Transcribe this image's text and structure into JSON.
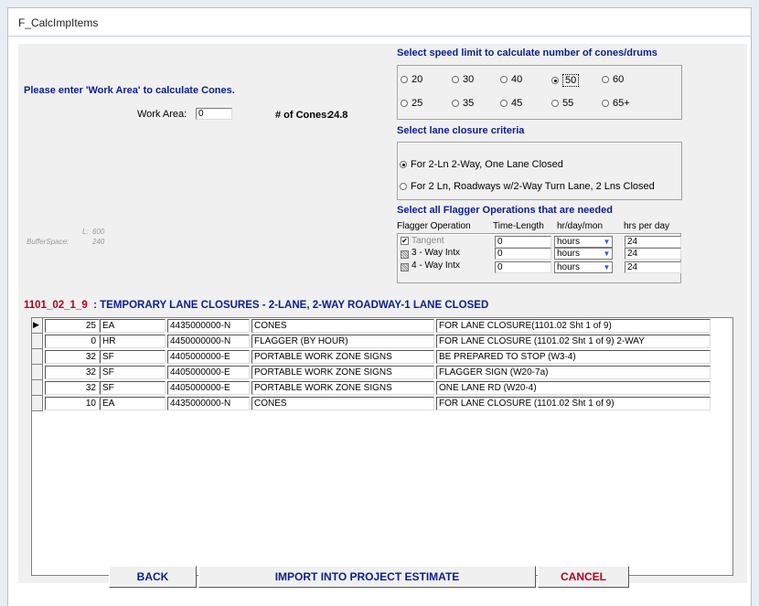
{
  "window": {
    "title": "F_CalcImpItems"
  },
  "left": {
    "prompt": "Please enter 'Work Area' to calculate Cones.",
    "work_area_label": "Work Area:",
    "work_area_value": "0",
    "cones_label": "# of Cones:",
    "cones_value": "24.8",
    "l_label": "L:",
    "l_value": "600",
    "buffer_label": "BufferSpace:",
    "buffer_value": "240"
  },
  "speed": {
    "heading": "Select speed limit to calculate number of cones/drums",
    "row1": [
      "20",
      "30",
      "40",
      "50",
      "60"
    ],
    "row2": [
      "25",
      "35",
      "45",
      "55",
      "65+"
    ],
    "selected": "50"
  },
  "lane": {
    "heading": "Select lane closure criteria",
    "options": [
      "For 2-Ln 2-Way, One Lane Closed",
      "For 2 Ln, Roadways w/2-Way Turn Lane, 2 Lns Closed"
    ],
    "selected_index": 0
  },
  "flagger": {
    "heading": "Select all Flagger Operations that are needed",
    "headers": [
      "Flagger Operation",
      "Time-Length",
      "hr/day/mon",
      "hrs per day"
    ],
    "rows": [
      {
        "name": "Tangent",
        "time": "0",
        "unit": "hours",
        "hrs": "24",
        "state": "checked"
      },
      {
        "name": "3 - Way Intx",
        "time": "0",
        "unit": "hours",
        "hrs": "24",
        "state": "indeterminate"
      },
      {
        "name": "4 - Way Intx",
        "time": "0",
        "unit": "hours",
        "hrs": "24",
        "state": "indeterminate"
      }
    ]
  },
  "section": {
    "code": "1101_02_1_9",
    "title": "  : TEMPORARY LANE CLOSURES - 2-LANE, 2-WAY ROADWAY-1 LANE CLOSED"
  },
  "table": {
    "rows": [
      [
        "25",
        "EA",
        "4435000000-N",
        "CONES",
        "FOR LANE CLOSURE(1101.02 Sht 1 of 9)"
      ],
      [
        "0",
        "HR",
        "4450000000-N",
        "FLAGGER (BY HOUR)",
        "FOR LANE CLOSURE (1101.02 Sht 1 of 9) 2-WAY"
      ],
      [
        "32",
        "SF",
        "4405000000-E",
        "PORTABLE WORK ZONE SIGNS",
        "BE PREPARED TO STOP (W3-4)"
      ],
      [
        "32",
        "SF",
        "4405000000-E",
        "PORTABLE WORK ZONE SIGNS",
        "FLAGGER SIGN (W20-7a)"
      ],
      [
        "32",
        "SF",
        "4405000000-E",
        "PORTABLE WORK ZONE SIGNS",
        "ONE LANE RD (W20-4)"
      ],
      [
        "10",
        "EA",
        "4435000000-N",
        "CONES",
        "FOR LANE CLOSURE (1101.02 Sht 1 of 9)"
      ]
    ]
  },
  "buttons": {
    "back": "BACK",
    "import": "IMPORT INTO PROJECT ESTIMATE",
    "cancel": "CANCEL"
  },
  "colors": {
    "heading_blue": "#0a1f8f",
    "code_red": "#b3001b",
    "form_bg": "#f0f0f0"
  }
}
